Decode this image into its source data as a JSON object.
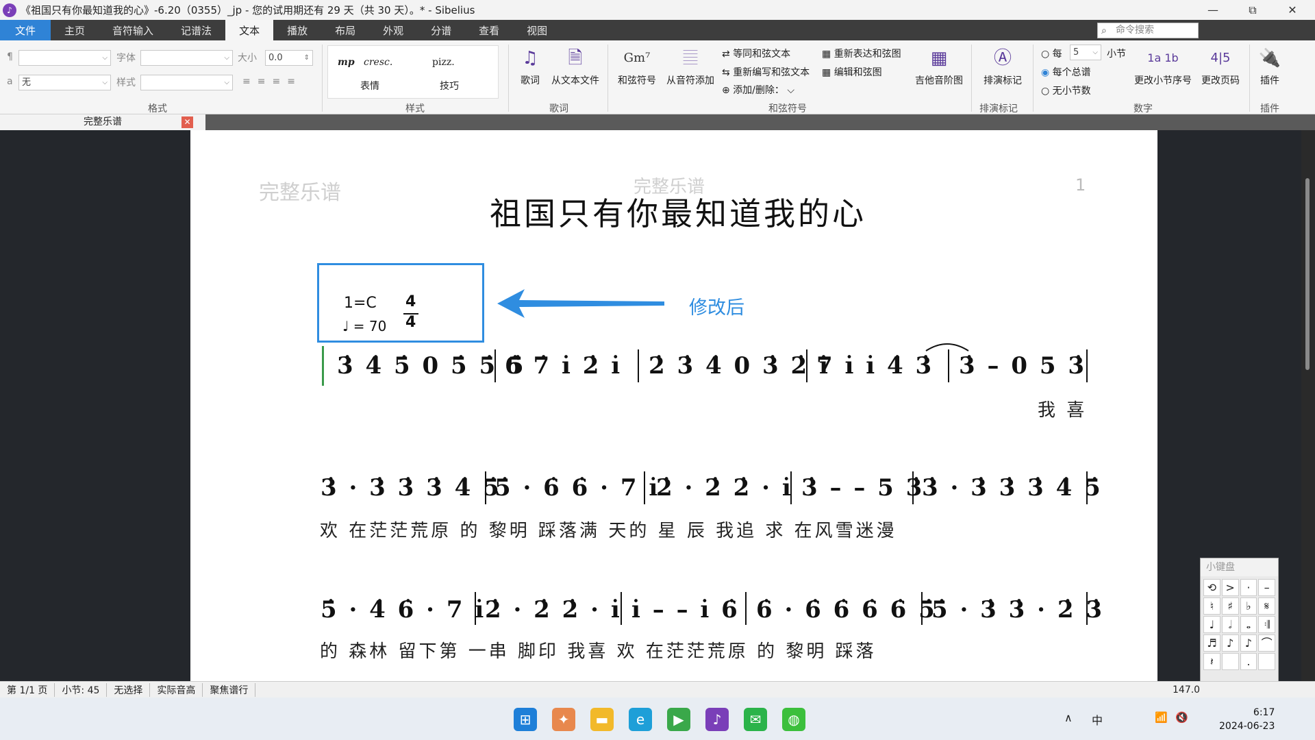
{
  "window": {
    "title": "《祖国只有你最知道我的心》-6.20（0355）_jp - 您的试用期还有 29 天（共 30 天）。* - Sibelius",
    "min": "—",
    "max": "⧉",
    "close": "✕"
  },
  "menu": {
    "file": "文件",
    "items": [
      "主页",
      "音符输入",
      "记谱法",
      "文本",
      "播放",
      "布局",
      "外观",
      "分谱",
      "查看",
      "视图"
    ],
    "search_placeholder": "命令搜索"
  },
  "ribbon": {
    "format": {
      "para_symbol": "¶",
      "a_symbol": "a",
      "font_label": "字体",
      "size_label": "大小",
      "size_value": "0.0",
      "style_label": "样式",
      "a_value": "无",
      "group": "格式"
    },
    "styles": {
      "mp": "mp",
      "cresc": "cresc.",
      "pizz": "pizz.",
      "expr": "表情",
      "tech": "技巧",
      "group": "样式"
    },
    "lyrics": {
      "lyrics_btn": "歌词",
      "from_text": "从文本文件",
      "group": "歌词"
    },
    "chord": {
      "chord_symbol": "和弦符号",
      "from_notes": "从音符添加",
      "equiv": "等同和弦文本",
      "respell": "重新编写和弦文本",
      "add_remove": "添加/删除：",
      "respell_chord": "重新表达和弦图",
      "edit_chord": "编辑和弦图",
      "guitar": "吉他音阶图",
      "group": "和弦符号",
      "gm7": "Gm⁷"
    },
    "rehearsal": {
      "label": "排演标记",
      "group": "排演标记"
    },
    "numbering": {
      "every": "每",
      "every_value": "5",
      "bar": "小节",
      "every_system": "每个总谱",
      "none": "无小节数",
      "change_bar": "更改小节序号",
      "change_page": "更改页码",
      "group": "数字"
    },
    "plugins": {
      "label": "插件",
      "group": "插件"
    }
  },
  "doc_tab": {
    "label": "完整乐谱"
  },
  "score": {
    "watermark_left": "完整乐谱",
    "watermark_center": "完整乐谱",
    "page_number": "1",
    "title": "祖国只有你最知道我的心",
    "key": "1=C",
    "time_top": "4",
    "time_bottom": "4",
    "tempo": "♩ = 70",
    "annotation": "修改后",
    "rows": [
      {
        "notes": [
          "3̇ 4̇ 5̇  0 5̇ 5̇ 5̇",
          "6̇ 7̇ i̇  2̇  i̇",
          "2̇ 3̇ 4̇  0 3̇ 2̇ i̇",
          "7 i̇  i̇  4̇  3̇",
          "3̇ – 0 5 3̇"
        ],
        "lyrics": "我 喜"
      },
      {
        "notes": [
          "3̇ ·  3̇ 3̇ 3̇ 4̇ 5̇",
          "5̇ ·  6̇ 6̇ ·  7 i̇",
          "2̇ ·  2̇ 2̇ ·  i̇",
          "3̇ – –  5 3̇",
          "3̇ ·  3̇ 3̇ 3̇ 4̇ 5̇"
        ],
        "lyrics": "欢 在茫茫荒原 的 黎明 踩落满 天的 星 辰  我追 求 在风雪迷漫"
      },
      {
        "notes": [
          "5̇ ·  4̇ 6̇ ·  7 i̇",
          "2̇ ·  2̇ 2̇ ·  i̇",
          "i̇ – –  i̇ 6̇",
          "6̇ ·  6̇ 6̇ 6̇ 6̇ 5̇",
          "5̇ ·  3̇ 3̇ ·  2̇ 3̇"
        ],
        "lyrics": "的 森林 留下第 一串 脚印  我喜 欢 在茫茫荒原 的 黎明 踩落"
      }
    ]
  },
  "keypad": {
    "title": "小键盘",
    "keys": [
      "⟲",
      ">",
      "·",
      "–",
      "♮",
      "♯",
      "♭",
      "𝄋",
      "♩",
      "𝅗𝅥",
      "𝅝",
      "𝄇",
      "♬",
      "♪",
      "♪",
      "⌒",
      "𝄽",
      "",
      ".",
      ""
    ]
  },
  "status": [
    "第 1/1 页",
    "小节: 45",
    "无选择",
    "实际音高",
    "聚焦谱行"
  ],
  "zoom": "147.0",
  "clock": {
    "time": "6:17",
    "date": "2024-06-23"
  },
  "tray": {
    "ime": "中"
  }
}
